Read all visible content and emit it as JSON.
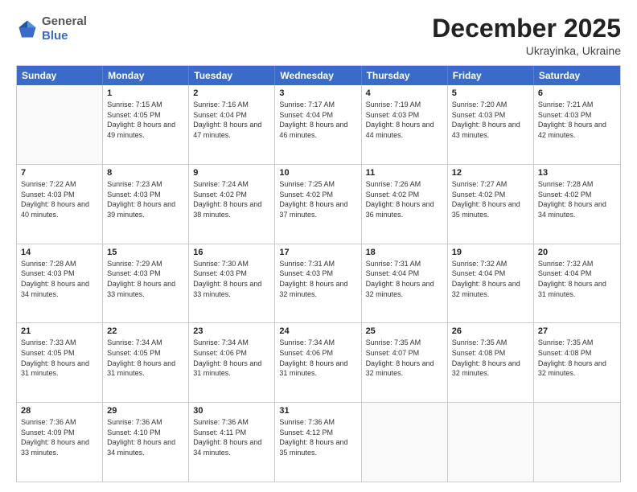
{
  "header": {
    "logo_general": "General",
    "logo_blue": "Blue",
    "month_title": "December 2025",
    "location": "Ukrayinka, Ukraine"
  },
  "days_of_week": [
    "Sunday",
    "Monday",
    "Tuesday",
    "Wednesday",
    "Thursday",
    "Friday",
    "Saturday"
  ],
  "weeks": [
    [
      {
        "day": "",
        "sunrise": "",
        "sunset": "",
        "daylight": ""
      },
      {
        "day": "1",
        "sunrise": "7:15 AM",
        "sunset": "4:05 PM",
        "daylight": "8 hours and 49 minutes."
      },
      {
        "day": "2",
        "sunrise": "7:16 AM",
        "sunset": "4:04 PM",
        "daylight": "8 hours and 47 minutes."
      },
      {
        "day": "3",
        "sunrise": "7:17 AM",
        "sunset": "4:04 PM",
        "daylight": "8 hours and 46 minutes."
      },
      {
        "day": "4",
        "sunrise": "7:19 AM",
        "sunset": "4:03 PM",
        "daylight": "8 hours and 44 minutes."
      },
      {
        "day": "5",
        "sunrise": "7:20 AM",
        "sunset": "4:03 PM",
        "daylight": "8 hours and 43 minutes."
      },
      {
        "day": "6",
        "sunrise": "7:21 AM",
        "sunset": "4:03 PM",
        "daylight": "8 hours and 42 minutes."
      }
    ],
    [
      {
        "day": "7",
        "sunrise": "7:22 AM",
        "sunset": "4:03 PM",
        "daylight": "8 hours and 40 minutes."
      },
      {
        "day": "8",
        "sunrise": "7:23 AM",
        "sunset": "4:03 PM",
        "daylight": "8 hours and 39 minutes."
      },
      {
        "day": "9",
        "sunrise": "7:24 AM",
        "sunset": "4:02 PM",
        "daylight": "8 hours and 38 minutes."
      },
      {
        "day": "10",
        "sunrise": "7:25 AM",
        "sunset": "4:02 PM",
        "daylight": "8 hours and 37 minutes."
      },
      {
        "day": "11",
        "sunrise": "7:26 AM",
        "sunset": "4:02 PM",
        "daylight": "8 hours and 36 minutes."
      },
      {
        "day": "12",
        "sunrise": "7:27 AM",
        "sunset": "4:02 PM",
        "daylight": "8 hours and 35 minutes."
      },
      {
        "day": "13",
        "sunrise": "7:28 AM",
        "sunset": "4:02 PM",
        "daylight": "8 hours and 34 minutes."
      }
    ],
    [
      {
        "day": "14",
        "sunrise": "7:28 AM",
        "sunset": "4:03 PM",
        "daylight": "8 hours and 34 minutes."
      },
      {
        "day": "15",
        "sunrise": "7:29 AM",
        "sunset": "4:03 PM",
        "daylight": "8 hours and 33 minutes."
      },
      {
        "day": "16",
        "sunrise": "7:30 AM",
        "sunset": "4:03 PM",
        "daylight": "8 hours and 33 minutes."
      },
      {
        "day": "17",
        "sunrise": "7:31 AM",
        "sunset": "4:03 PM",
        "daylight": "8 hours and 32 minutes."
      },
      {
        "day": "18",
        "sunrise": "7:31 AM",
        "sunset": "4:04 PM",
        "daylight": "8 hours and 32 minutes."
      },
      {
        "day": "19",
        "sunrise": "7:32 AM",
        "sunset": "4:04 PM",
        "daylight": "8 hours and 32 minutes."
      },
      {
        "day": "20",
        "sunrise": "7:32 AM",
        "sunset": "4:04 PM",
        "daylight": "8 hours and 31 minutes."
      }
    ],
    [
      {
        "day": "21",
        "sunrise": "7:33 AM",
        "sunset": "4:05 PM",
        "daylight": "8 hours and 31 minutes."
      },
      {
        "day": "22",
        "sunrise": "7:34 AM",
        "sunset": "4:05 PM",
        "daylight": "8 hours and 31 minutes."
      },
      {
        "day": "23",
        "sunrise": "7:34 AM",
        "sunset": "4:06 PM",
        "daylight": "8 hours and 31 minutes."
      },
      {
        "day": "24",
        "sunrise": "7:34 AM",
        "sunset": "4:06 PM",
        "daylight": "8 hours and 31 minutes."
      },
      {
        "day": "25",
        "sunrise": "7:35 AM",
        "sunset": "4:07 PM",
        "daylight": "8 hours and 32 minutes."
      },
      {
        "day": "26",
        "sunrise": "7:35 AM",
        "sunset": "4:08 PM",
        "daylight": "8 hours and 32 minutes."
      },
      {
        "day": "27",
        "sunrise": "7:35 AM",
        "sunset": "4:08 PM",
        "daylight": "8 hours and 32 minutes."
      }
    ],
    [
      {
        "day": "28",
        "sunrise": "7:36 AM",
        "sunset": "4:09 PM",
        "daylight": "8 hours and 33 minutes."
      },
      {
        "day": "29",
        "sunrise": "7:36 AM",
        "sunset": "4:10 PM",
        "daylight": "8 hours and 34 minutes."
      },
      {
        "day": "30",
        "sunrise": "7:36 AM",
        "sunset": "4:11 PM",
        "daylight": "8 hours and 34 minutes."
      },
      {
        "day": "31",
        "sunrise": "7:36 AM",
        "sunset": "4:12 PM",
        "daylight": "8 hours and 35 minutes."
      },
      {
        "day": "",
        "sunrise": "",
        "sunset": "",
        "daylight": ""
      },
      {
        "day": "",
        "sunrise": "",
        "sunset": "",
        "daylight": ""
      },
      {
        "day": "",
        "sunrise": "",
        "sunset": "",
        "daylight": ""
      }
    ]
  ]
}
